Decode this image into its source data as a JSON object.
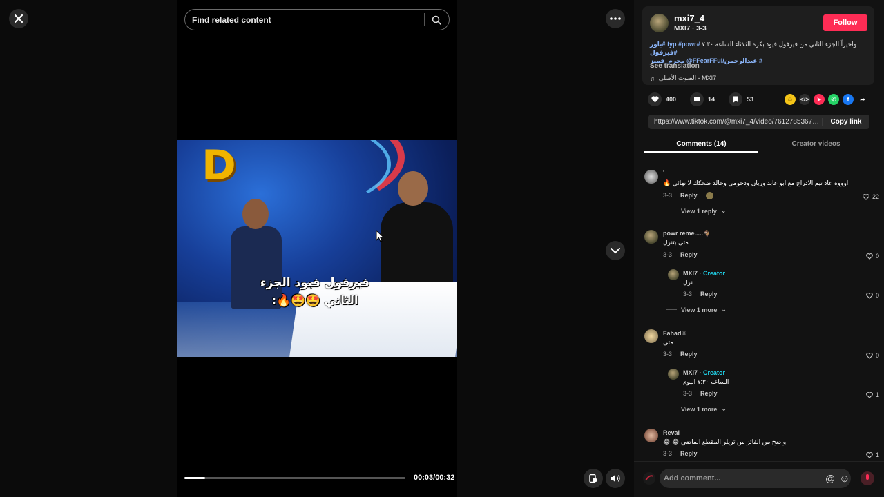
{
  "viewer": {
    "search_placeholder": "Find related content",
    "caption_line1": "فيرفول فيود الجزء",
    "caption_line2": "الثاني 🤩🤩🔥:",
    "time": "00:03/00:32",
    "progress": 0.094
  },
  "author": {
    "username": "mxi7_4",
    "subline": "MXI7 · 3-3",
    "follow_label": "Follow"
  },
  "description": {
    "text": "واخيراً الجزء الثاني من فيرفول فيود بكره الثلاثاء الساعه ٧:٣٠",
    "tags_line1": "#fyp #powr #باور #فيرفول",
    "tags_line2": "# عبدالرحمن/FFearFFul@ مجرم_قميز",
    "see_translation": "See translation",
    "music": "الصوت الأصلي - MXI7"
  },
  "stats": {
    "likes": "400",
    "comments": "14",
    "saves": "53"
  },
  "share": {
    "url": "https://www.tiktok.com/@mxi7_4/video/761278536780...",
    "copy_label": "Copy link"
  },
  "tabs": {
    "comments": "Comments (14)",
    "creator_videos": "Creator videos"
  },
  "comments": [
    {
      "name": "'",
      "text": "اوووه عاد تيم الادراج مع ابو عابد وريان ودحومي وخالد ضحكك لا نهائي 🔥",
      "date": "3-3",
      "reply": "Reply",
      "likes": "22",
      "view_more": "View 1 reply"
    },
    {
      "name": "powr reme.....🐐",
      "text": "متى بتنزل",
      "date": "3-3",
      "reply": "Reply",
      "likes": "0"
    },
    {
      "name": "MXI7",
      "creator": "Creator",
      "text": "نزل",
      "date": "3-3",
      "reply": "Reply",
      "likes": "0",
      "view_more": "View 1 more"
    },
    {
      "name": "Fahad⚛",
      "text": "متى",
      "date": "3-3",
      "reply": "Reply",
      "likes": "0"
    },
    {
      "name": "MXI7",
      "creator": "Creator",
      "text": "الساعه ٧:٣٠ اليوم",
      "date": "3-3",
      "reply": "Reply",
      "likes": "1",
      "view_more": "View 1 more"
    },
    {
      "name": "Reval",
      "text": "واضح من الفائز من تريلر المقطع الماضي 😂 😂",
      "date": "3-3",
      "reply": "Reply",
      "likes": "1"
    }
  ],
  "composer": {
    "placeholder": "Add comment..."
  },
  "colors": {
    "accent": "#fe2c55",
    "creator": "#20d5ec",
    "link": "#8ab4f8"
  }
}
